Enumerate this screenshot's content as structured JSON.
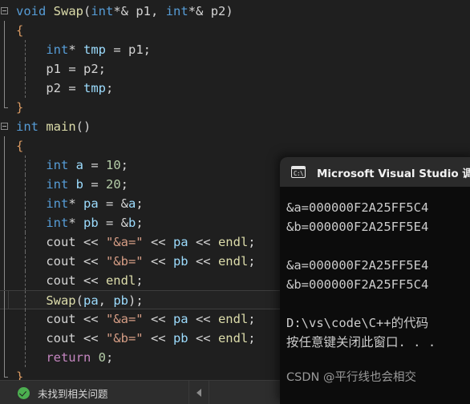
{
  "editor": {
    "lines": [
      {
        "gutter": "collapse-open",
        "indent": 0,
        "tokens": [
          {
            "t": "void",
            "c": "kw"
          },
          {
            "t": " ",
            "c": "plain"
          },
          {
            "t": "Swap",
            "c": "fn"
          },
          {
            "t": "(",
            "c": "punct"
          },
          {
            "t": "int",
            "c": "kw"
          },
          {
            "t": "*& ",
            "c": "plain"
          },
          {
            "t": "p1",
            "c": "plain"
          },
          {
            "t": ", ",
            "c": "punct"
          },
          {
            "t": "int",
            "c": "kw"
          },
          {
            "t": "*& ",
            "c": "plain"
          },
          {
            "t": "p2",
            "c": "plain"
          },
          {
            "t": ")",
            "c": "punct"
          }
        ]
      },
      {
        "gutter": "bar",
        "indent": 0,
        "tokens": [
          {
            "t": "{",
            "c": "brace"
          }
        ]
      },
      {
        "gutter": "bar",
        "guide": true,
        "indent": 1,
        "tokens": [
          {
            "t": "int",
            "c": "kw"
          },
          {
            "t": "* ",
            "c": "plain"
          },
          {
            "t": "tmp",
            "c": "ident"
          },
          {
            "t": " = ",
            "c": "plain"
          },
          {
            "t": "p1",
            "c": "plain"
          },
          {
            "t": ";",
            "c": "punct"
          }
        ]
      },
      {
        "gutter": "bar",
        "guide": true,
        "indent": 1,
        "tokens": [
          {
            "t": "p1",
            "c": "plain"
          },
          {
            "t": " = ",
            "c": "plain"
          },
          {
            "t": "p2",
            "c": "plain"
          },
          {
            "t": ";",
            "c": "punct"
          }
        ]
      },
      {
        "gutter": "bar",
        "guide": true,
        "indent": 1,
        "tokens": [
          {
            "t": "p2",
            "c": "plain"
          },
          {
            "t": " = ",
            "c": "plain"
          },
          {
            "t": "tmp",
            "c": "ident"
          },
          {
            "t": ";",
            "c": "punct"
          }
        ]
      },
      {
        "gutter": "bar-last",
        "indent": 0,
        "tokens": [
          {
            "t": "}",
            "c": "brace"
          }
        ]
      },
      {
        "gutter": "collapse-open",
        "indent": 0,
        "tokens": [
          {
            "t": "int",
            "c": "kw"
          },
          {
            "t": " ",
            "c": "plain"
          },
          {
            "t": "main",
            "c": "fn"
          },
          {
            "t": "()",
            "c": "punct"
          }
        ]
      },
      {
        "gutter": "bar",
        "indent": 0,
        "tokens": [
          {
            "t": "{",
            "c": "brace"
          }
        ]
      },
      {
        "gutter": "bar",
        "guide": true,
        "indent": 1,
        "tokens": [
          {
            "t": "int",
            "c": "kw"
          },
          {
            "t": " ",
            "c": "plain"
          },
          {
            "t": "a",
            "c": "ident"
          },
          {
            "t": " = ",
            "c": "plain"
          },
          {
            "t": "10",
            "c": "num"
          },
          {
            "t": ";",
            "c": "punct"
          }
        ]
      },
      {
        "gutter": "bar",
        "guide": true,
        "indent": 1,
        "tokens": [
          {
            "t": "int",
            "c": "kw"
          },
          {
            "t": " ",
            "c": "plain"
          },
          {
            "t": "b",
            "c": "ident"
          },
          {
            "t": " = ",
            "c": "plain"
          },
          {
            "t": "20",
            "c": "num"
          },
          {
            "t": ";",
            "c": "punct"
          }
        ]
      },
      {
        "gutter": "bar",
        "guide": true,
        "indent": 1,
        "tokens": [
          {
            "t": "int",
            "c": "kw"
          },
          {
            "t": "* ",
            "c": "plain"
          },
          {
            "t": "pa",
            "c": "ident"
          },
          {
            "t": " = &",
            "c": "plain"
          },
          {
            "t": "a",
            "c": "ident"
          },
          {
            "t": ";",
            "c": "punct"
          }
        ]
      },
      {
        "gutter": "bar",
        "guide": true,
        "indent": 1,
        "tokens": [
          {
            "t": "int",
            "c": "kw"
          },
          {
            "t": "* ",
            "c": "plain"
          },
          {
            "t": "pb",
            "c": "ident"
          },
          {
            "t": " = &",
            "c": "plain"
          },
          {
            "t": "b",
            "c": "ident"
          },
          {
            "t": ";",
            "c": "punct"
          }
        ]
      },
      {
        "gutter": "bar",
        "guide": true,
        "indent": 1,
        "tokens": [
          {
            "t": "cout",
            "c": "obj"
          },
          {
            "t": " << ",
            "c": "plain"
          },
          {
            "t": "\"&a=\"",
            "c": "str"
          },
          {
            "t": " << ",
            "c": "plain"
          },
          {
            "t": "pa",
            "c": "ident"
          },
          {
            "t": " << ",
            "c": "plain"
          },
          {
            "t": "endl",
            "c": "fn"
          },
          {
            "t": ";",
            "c": "punct"
          }
        ]
      },
      {
        "gutter": "bar",
        "guide": true,
        "indent": 1,
        "tokens": [
          {
            "t": "cout",
            "c": "obj"
          },
          {
            "t": " << ",
            "c": "plain"
          },
          {
            "t": "\"&b=\"",
            "c": "str"
          },
          {
            "t": " << ",
            "c": "plain"
          },
          {
            "t": "pb",
            "c": "ident"
          },
          {
            "t": " << ",
            "c": "plain"
          },
          {
            "t": "endl",
            "c": "fn"
          },
          {
            "t": ";",
            "c": "punct"
          }
        ]
      },
      {
        "gutter": "bar",
        "guide": true,
        "indent": 1,
        "tokens": [
          {
            "t": "cout",
            "c": "obj"
          },
          {
            "t": " << ",
            "c": "plain"
          },
          {
            "t": "endl",
            "c": "fn"
          },
          {
            "t": ";",
            "c": "punct"
          }
        ]
      },
      {
        "gutter": "bar",
        "guide": true,
        "indent": 1,
        "current": true,
        "tokens": [
          {
            "t": "Swap",
            "c": "fn"
          },
          {
            "t": "(",
            "c": "punct"
          },
          {
            "t": "pa",
            "c": "ident"
          },
          {
            "t": ", ",
            "c": "punct"
          },
          {
            "t": "pb",
            "c": "ident"
          },
          {
            "t": ")",
            "c": "punct"
          },
          {
            "t": ";",
            "c": "punct"
          }
        ]
      },
      {
        "gutter": "bar",
        "guide": true,
        "indent": 1,
        "tokens": [
          {
            "t": "cout",
            "c": "obj"
          },
          {
            "t": " << ",
            "c": "plain"
          },
          {
            "t": "\"&a=\"",
            "c": "str"
          },
          {
            "t": " << ",
            "c": "plain"
          },
          {
            "t": "pa",
            "c": "ident"
          },
          {
            "t": " << ",
            "c": "plain"
          },
          {
            "t": "endl",
            "c": "fn"
          },
          {
            "t": ";",
            "c": "punct"
          }
        ]
      },
      {
        "gutter": "bar",
        "guide": true,
        "indent": 1,
        "tokens": [
          {
            "t": "cout",
            "c": "obj"
          },
          {
            "t": " << ",
            "c": "plain"
          },
          {
            "t": "\"&b=\"",
            "c": "str"
          },
          {
            "t": " << ",
            "c": "plain"
          },
          {
            "t": "pb",
            "c": "ident"
          },
          {
            "t": " << ",
            "c": "plain"
          },
          {
            "t": "endl",
            "c": "fn"
          },
          {
            "t": ";",
            "c": "punct"
          }
        ]
      },
      {
        "gutter": "bar",
        "guide": true,
        "indent": 1,
        "tokens": [
          {
            "t": "return",
            "c": "ctrl"
          },
          {
            "t": " ",
            "c": "plain"
          },
          {
            "t": "0",
            "c": "num"
          },
          {
            "t": ";",
            "c": "punct"
          }
        ]
      },
      {
        "gutter": "bar-last",
        "indent": 0,
        "tokens": [
          {
            "t": "}",
            "c": "brace"
          }
        ]
      }
    ]
  },
  "statusbar": {
    "icon": "check-circle-icon",
    "message": "未找到相关问题",
    "scroll_arrow_icon": "triangle-left-icon"
  },
  "console": {
    "icon": "console-window-icon",
    "icon_glyph": "C:\\",
    "title": "Microsoft Visual Studio 调试",
    "output_lines": [
      "&a=000000F2A25FF5C4",
      "&b=000000F2A25FF5E4",
      "",
      "&a=000000F2A25FF5E4",
      "&b=000000F2A25FF5C4",
      "",
      "D:\\vs\\code\\C++的代码",
      "按任意键关闭此窗口. . ."
    ],
    "watermark": "CSDN @平行线也会相交"
  },
  "colors": {
    "editor_bg": "#1f1f1f",
    "console_bg": "#0c0c0c",
    "console_titlebar_bg": "#2b2b2b",
    "statusbar_bg": "#2d2d2d",
    "keyword": "#569cd6",
    "function": "#dcdcaa",
    "identifier": "#9cdcfe",
    "string": "#d69d85",
    "number": "#b5cea8",
    "control": "#c586c0",
    "brace": "#da9a62",
    "status_ok": "#4caf50"
  }
}
